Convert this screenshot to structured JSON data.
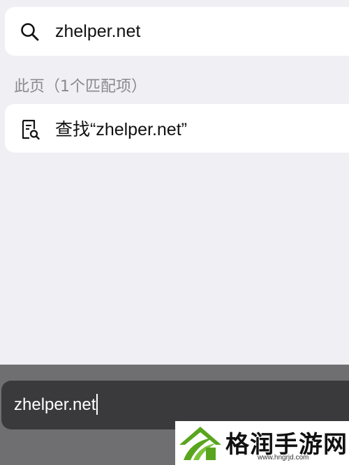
{
  "suggestion": {
    "icon": "search-icon",
    "label": "zhelper.net"
  },
  "section": {
    "header": "此页（1个匹配项）"
  },
  "find_on_page": {
    "icon": "find-document-icon",
    "label": "查找“zhelper.net”"
  },
  "address_bar": {
    "value": "zhelper.net"
  },
  "watermark": {
    "title": "格润手游网",
    "url": "www.hngrjd.com"
  },
  "colors": {
    "background": "#efeff4",
    "card": "#ffffff",
    "toolbar": "#6f6f72",
    "address_field": "#3a3a3c",
    "logo_green": "#5aa51e"
  }
}
